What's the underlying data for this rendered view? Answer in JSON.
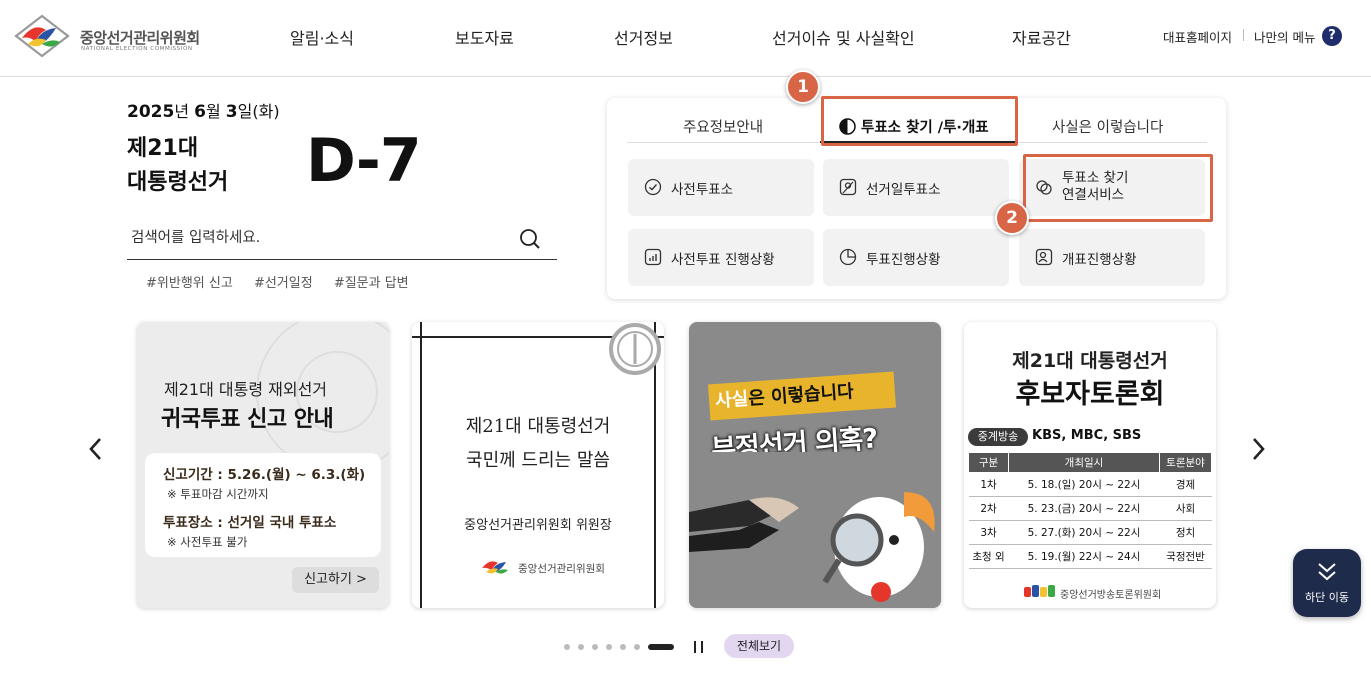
{
  "header": {
    "logo_text": "중앙선거관리위원회",
    "logo_sub": "NATIONAL ELECTION COMMISSION",
    "nav": [
      "알림·소식",
      "보도자료",
      "선거정보",
      "선거이슈 및 사실확인",
      "자료공간"
    ],
    "util": [
      "대표홈페이지",
      "나만의 메뉴"
    ],
    "help_label": "?"
  },
  "election": {
    "date_year": "2025",
    "date_year_unit": "년 ",
    "date_month": "6",
    "date_month_unit": "월 ",
    "date_day": "3",
    "date_day_unit": "일(화)",
    "name_line1": "제21대",
    "name_line2": "대통령선거",
    "dday": "D-7"
  },
  "search": {
    "placeholder": "검색어를 입력하세요.",
    "tags": [
      "#위반행위 신고",
      "#선거일정",
      "#질문과 답변"
    ]
  },
  "panel": {
    "tabs": [
      "주요정보안내",
      "투표소 찾기 /투·개표",
      "사실은 이렇습니다"
    ],
    "active_tab": 1,
    "cards": [
      {
        "label": "사전투표소",
        "icon": "check-circle-icon"
      },
      {
        "label": "선거일투표소",
        "icon": "map-pin-icon"
      },
      {
        "label": "투표소 찾기\n연결서비스",
        "label_line1": "투표소 찾기",
        "label_line2": "연결서비스",
        "icon": "link-circles-icon"
      },
      {
        "label": "사전투표 진행상황",
        "icon": "bar-chart-icon"
      },
      {
        "label": "투표진행상황",
        "icon": "pie-chart-icon"
      },
      {
        "label": "개표진행상황",
        "icon": "person-check-icon"
      }
    ],
    "highlight_1": "1",
    "highlight_2": "2"
  },
  "banners": {
    "b1": {
      "sub": "제21대 대통령 재외선거",
      "title": "귀국투표 신고 안내",
      "l1": "신고기간 : 5.26.(월) ~ 6.3.(화)",
      "l2": "※ 투표마감 시간까지",
      "l3": "투표장소 : 선거일 국내 투표소",
      "l4": "※ 사전투표 불가",
      "button": "신고하기 >"
    },
    "b2": {
      "l1": "제21대 대통령선거",
      "l2": "국민께 드리는 말씀",
      "l3": "중앙선거관리위원회 위원장",
      "logo": "중앙선거관리위원회"
    },
    "b3": {
      "t1_highlight": "사실",
      "t1_rest": "은 이렇습니다",
      "t2": "부정선거 의혹?"
    },
    "b4": {
      "t1": "제21대 대통령선거",
      "t2": "후보자토론회",
      "broadcast_label": "중계방송",
      "channels": "KBS, MBC, SBS",
      "headers": [
        "구분",
        "개최일시",
        "토론분야"
      ],
      "rows": [
        [
          "1차",
          "5. 18.(일) 20시 ~ 22시",
          "경제"
        ],
        [
          "2차",
          "5. 23.(금) 20시 ~ 22시",
          "사회"
        ],
        [
          "3차",
          "5. 27.(화) 20시 ~ 22시",
          "정치"
        ],
        [
          "초청 외",
          "5. 19.(월) 22시 ~ 24시",
          "국정전반"
        ]
      ],
      "logo": "중앙선거방송토론위원회"
    }
  },
  "pager": {
    "view_all": "전체보기",
    "total_dots": 7,
    "active_dot": 7
  },
  "float_button": {
    "label": "하단 이동"
  },
  "colors": {
    "highlight": "#d96547",
    "navy": "#1f2b4b",
    "viewall_bg": "#e3d6f0"
  }
}
